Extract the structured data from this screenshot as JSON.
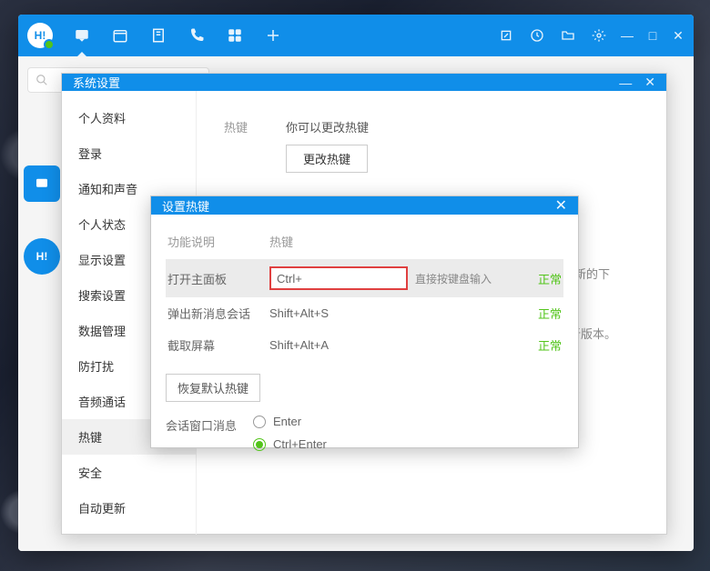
{
  "settings": {
    "title": "系统设置",
    "sidebar": [
      "个人资料",
      "登录",
      "通知和声音",
      "个人状态",
      "显示设置",
      "搜索设置",
      "数据管理",
      "防打扰",
      "音频通话",
      "热键",
      "安全",
      "自动更新"
    ],
    "content": {
      "section_label": "热键",
      "hint": "你可以更改热键",
      "change_btn": "更改热键",
      "bg_text1": "完成更新的下",
      "bg_text2": "最新版本。"
    }
  },
  "hotkey": {
    "title": "设置热键",
    "headers": [
      "功能说明",
      "热键"
    ],
    "rows": [
      {
        "label": "打开主面板",
        "key": "Ctrl+",
        "hint": "直接按键盘输入",
        "status": "正常"
      },
      {
        "label": "弹出新消息会话",
        "key": "Shift+Alt+S",
        "hint": "",
        "status": "正常"
      },
      {
        "label": "截取屏幕",
        "key": "Shift+Alt+A",
        "hint": "",
        "status": "正常"
      }
    ],
    "restore_btn": "恢复默认热键",
    "send_label": "会话窗口消息",
    "send_options": [
      "Enter",
      "Ctrl+Enter"
    ]
  }
}
